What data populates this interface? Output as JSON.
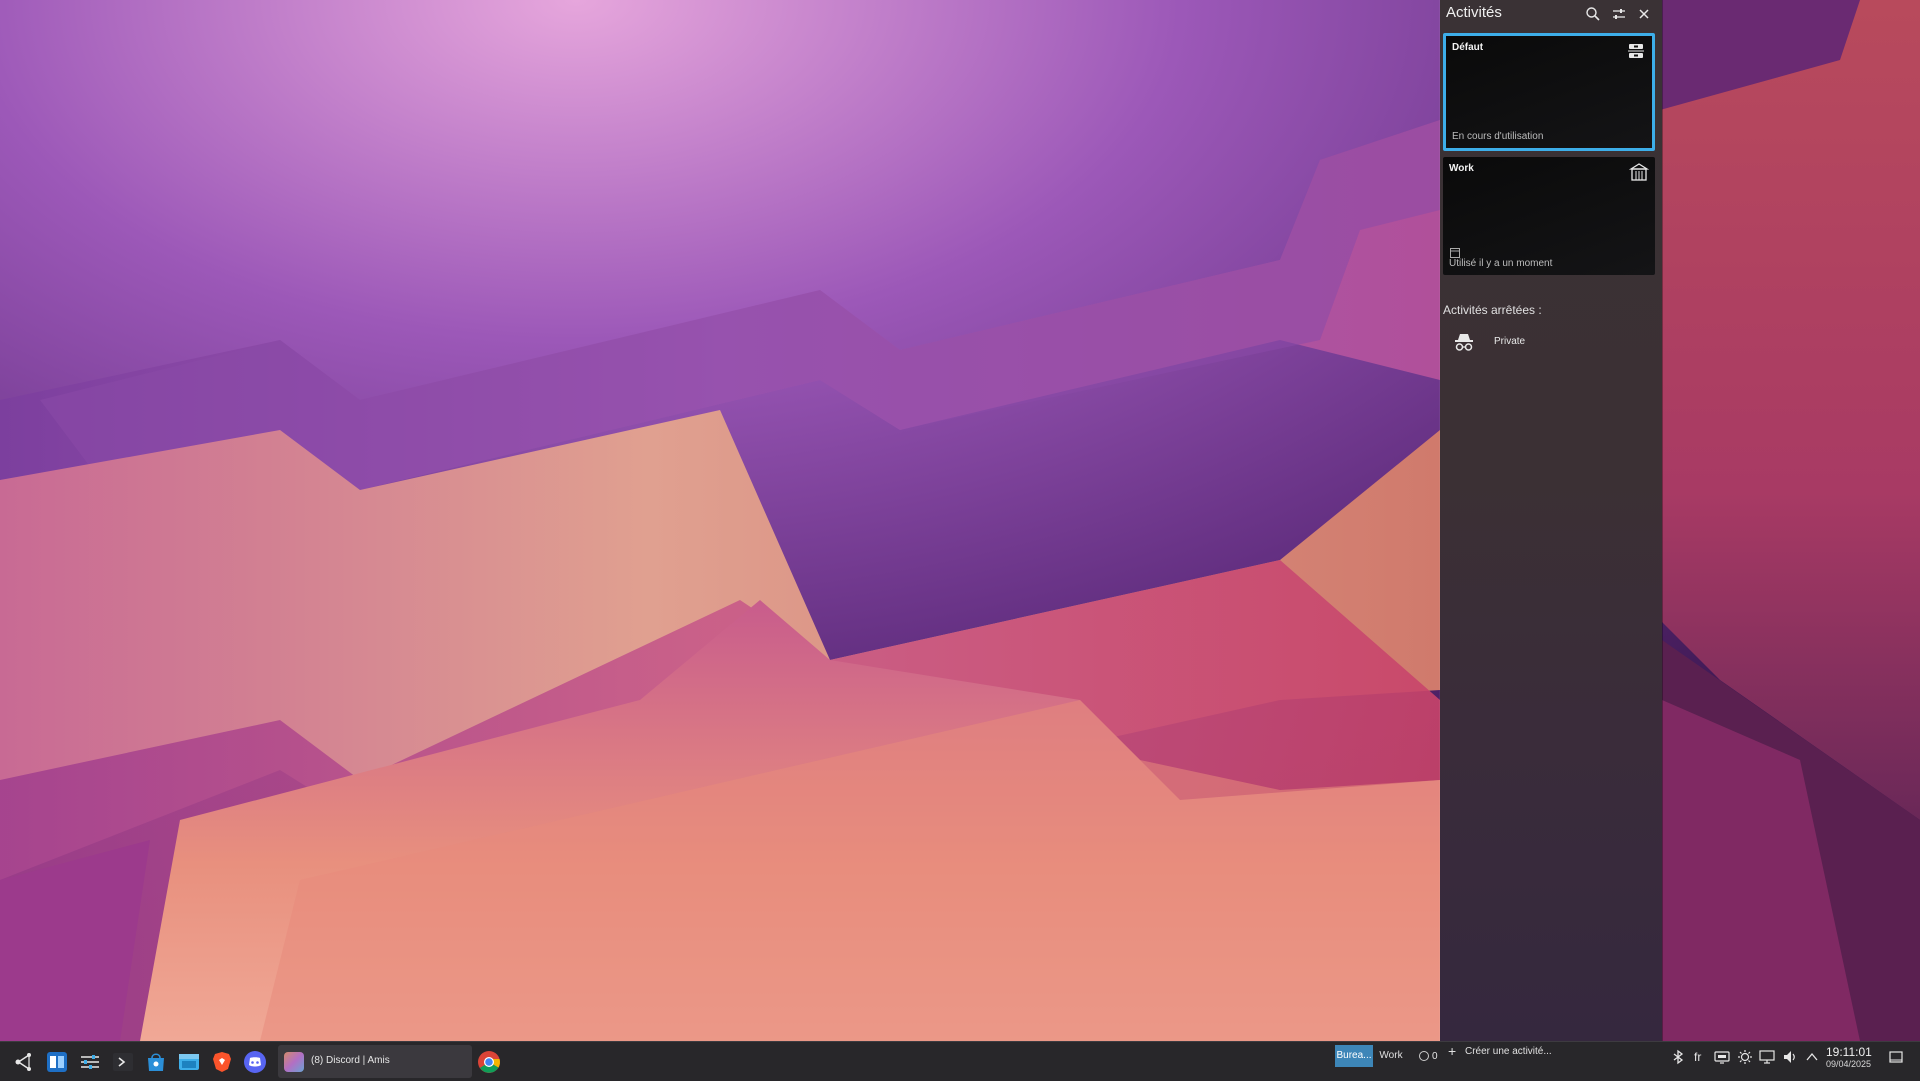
{
  "colors": {
    "accent": "#3daee9",
    "panel_bg": "#3a3235",
    "taskbar_bg": "#28272a",
    "pager_active": "#3d86b8"
  },
  "activities_panel": {
    "title": "Activités",
    "header_icons": [
      "search-icon",
      "configure-icon",
      "close-icon"
    ],
    "activities": [
      {
        "name": "Défaut",
        "status": "En cours d'utilisation",
        "icon": "activity-default-icon",
        "current": true
      },
      {
        "name": "Work",
        "status": "Utilisé il y a un moment",
        "icon": "building-icon",
        "current": false
      }
    ],
    "stopped_heading": "Activités arrêtées :",
    "stopped": [
      {
        "name": "Private",
        "icon": "incognito-icon"
      }
    ],
    "create_label": "Créer une activité..."
  },
  "taskbar": {
    "launchers": [
      "kde-launcher-icon",
      "vscode-icon",
      "system-settings-icon",
      "terminal-icon",
      "store-icon",
      "file-manager-icon",
      "brave-icon",
      "discord-icon"
    ],
    "discord_task_label": "(8) Discord | Amis",
    "chrome_icon": "chrome-icon",
    "pager": {
      "active": "Burea...",
      "other": "Work"
    },
    "hidden_partial_text": "0",
    "tray": {
      "keyboard_layout": "fr",
      "icons": [
        "bluetooth-icon",
        "network-icon",
        "brightness-icon",
        "display-icon",
        "volume-icon",
        "chevron-up-icon",
        "show-desktop-icon"
      ]
    },
    "clock": {
      "time": "19:11:01",
      "date": "09/04/2025"
    }
  }
}
